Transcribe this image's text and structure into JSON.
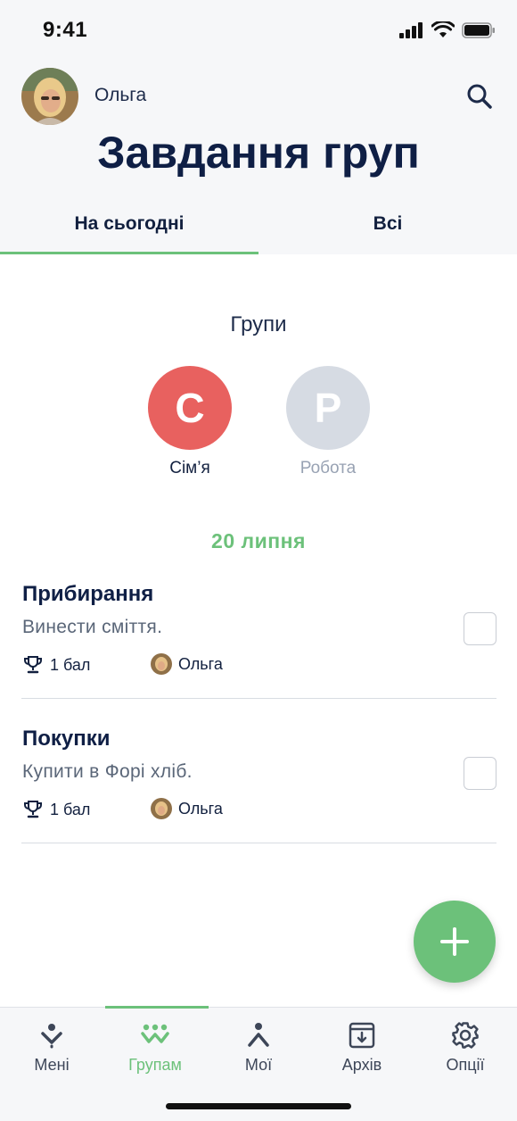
{
  "status_bar": {
    "time": "9:41"
  },
  "header": {
    "user_name": "Ольга",
    "title": "Завдання груп"
  },
  "tabs": [
    {
      "label": "На сьогодні",
      "active": true
    },
    {
      "label": "Всі",
      "active": false
    }
  ],
  "groups": {
    "title": "Групи",
    "items": [
      {
        "initial": "С",
        "label": "Сім’я",
        "color": "#e8615f",
        "label_color": "#12203f"
      },
      {
        "initial": "Р",
        "label": "Робота",
        "color": "#d6dbe3",
        "label_color": "#98a2b3"
      }
    ]
  },
  "date": "20 липня",
  "tasks": [
    {
      "title": "Прибирання",
      "description": "Винести сміття.",
      "points": "1 бал",
      "assignee": "Ольга",
      "done": false
    },
    {
      "title": "Покупки",
      "description": "Купити в Форі хліб.",
      "points": "1 бал",
      "assignee": "Ольга",
      "done": false
    }
  ],
  "tabbar": [
    {
      "label": "Мені",
      "icon": "arrow-down-person-icon",
      "active": false
    },
    {
      "label": "Групам",
      "icon": "group-people-icon",
      "active": true
    },
    {
      "label": "Мої",
      "icon": "person-icon",
      "active": false
    },
    {
      "label": "Архів",
      "icon": "archive-icon",
      "active": false
    },
    {
      "label": "Опції",
      "icon": "gear-icon",
      "active": false
    }
  ],
  "colors": {
    "accent": "#6cc17a",
    "title": "#0f1f45"
  }
}
